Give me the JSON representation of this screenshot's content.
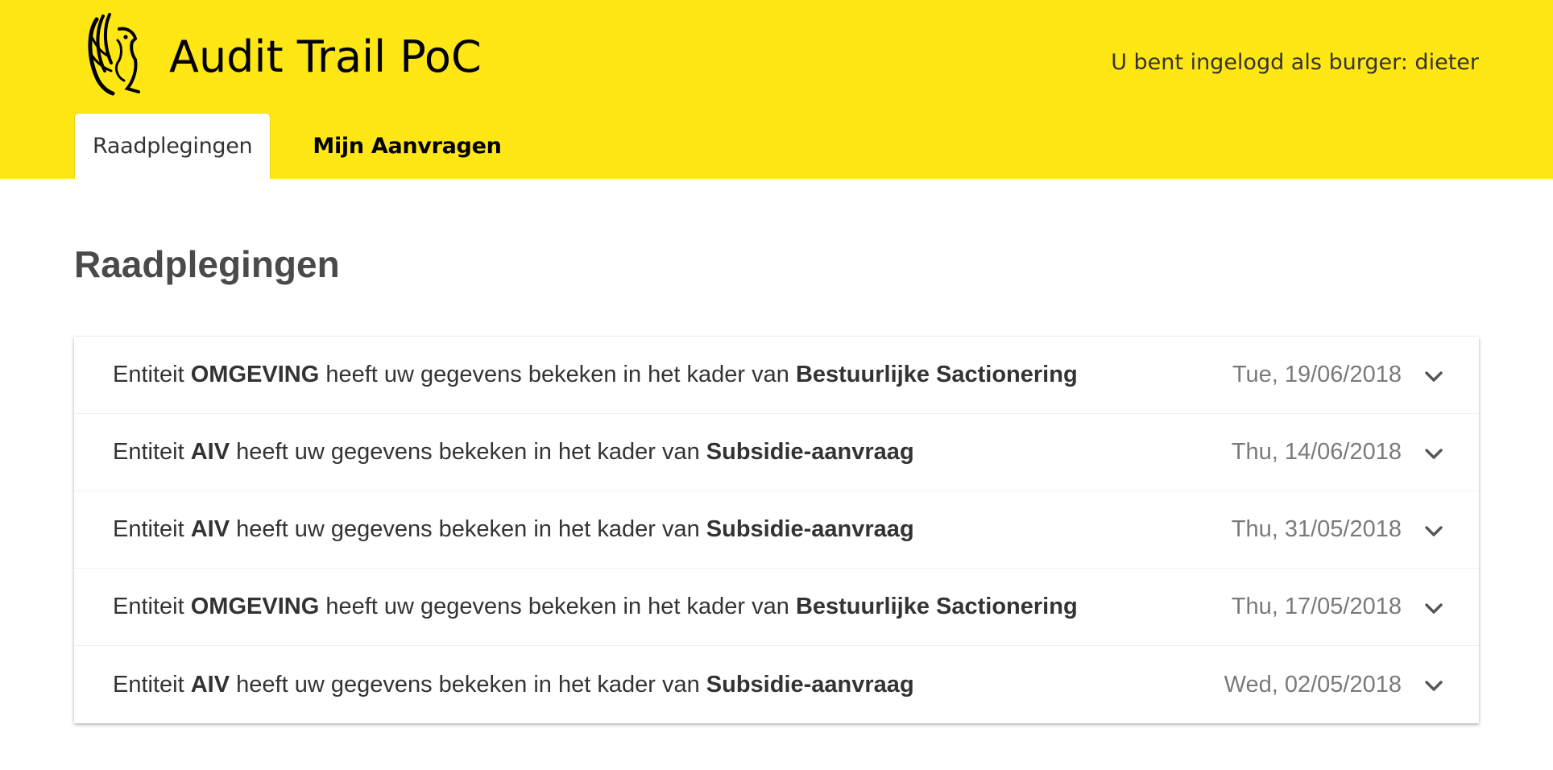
{
  "header": {
    "app_title": "Audit Trail PoC",
    "login_status": "U bent ingelogd als burger: dieter",
    "brand_color": "#ffe615",
    "logo_icon": "flemish-lion-icon"
  },
  "tabs": [
    {
      "label": "Raadplegingen",
      "active": true
    },
    {
      "label": "Mijn Aanvragen",
      "active": false
    }
  ],
  "main": {
    "title": "Raadplegingen",
    "consultations": [
      {
        "prefix": "Entiteit",
        "entity": "OMGEVING",
        "middle": "heeft uw gegevens bekeken in het kader van",
        "context": "Bestuurlijke Sactionering",
        "date": "Tue, 19/06/2018",
        "icon": "chevron-down-icon"
      },
      {
        "prefix": "Entiteit",
        "entity": "AIV",
        "middle": "heeft uw gegevens bekeken in het kader van",
        "context": "Subsidie-aanvraag",
        "date": "Thu, 14/06/2018",
        "icon": "chevron-down-icon"
      },
      {
        "prefix": "Entiteit",
        "entity": "AIV",
        "middle": "heeft uw gegevens bekeken in het kader van",
        "context": "Subsidie-aanvraag",
        "date": "Thu, 31/05/2018",
        "icon": "chevron-down-icon"
      },
      {
        "prefix": "Entiteit",
        "entity": "OMGEVING",
        "middle": "heeft uw gegevens bekeken in het kader van",
        "context": "Bestuurlijke Sactionering",
        "date": "Thu, 17/05/2018",
        "icon": "chevron-down-icon"
      },
      {
        "prefix": "Entiteit",
        "entity": "AIV",
        "middle": "heeft uw gegevens bekeken in het kader van",
        "context": "Subsidie-aanvraag",
        "date": "Wed, 02/05/2018",
        "icon": "chevron-down-icon"
      }
    ]
  }
}
